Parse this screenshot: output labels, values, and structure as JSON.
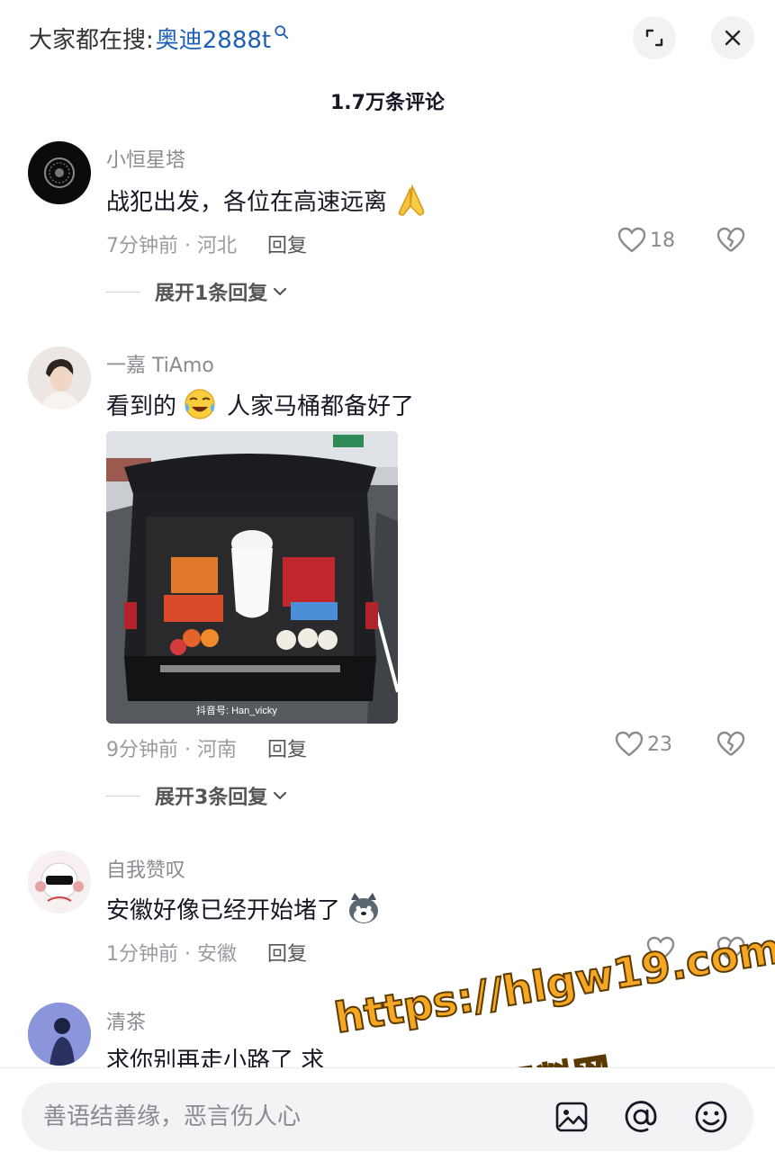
{
  "header": {
    "search_prefix": "大家都在搜:",
    "search_keyword": "奥迪2888t",
    "comment_count": "1.7万条评论"
  },
  "comments": [
    {
      "username": "小恒星塔",
      "text": "战犯出发，各位在高速远离",
      "emoji": "pray-hands",
      "time_location": "7分钟前 · 河北",
      "reply_label": "回复",
      "likes": "18",
      "expand_label": "展开1条回复"
    },
    {
      "username": "一嘉 TiAmo",
      "text_before": "看到的",
      "text_after": "人家马桶都备好了",
      "emoji": "crying-laughing",
      "image_description_watermark": "抖音号: Han_vicky",
      "time_location": "9分钟前 · 河南",
      "reply_label": "回复",
      "likes": "23",
      "expand_label": "展开3条回复"
    },
    {
      "username": "自我赞叹",
      "text": "安徽好像已经开始堵了",
      "emoji": "husky",
      "time_location": "1分钟前 · 安徽",
      "reply_label": "回复",
      "likes": ""
    },
    {
      "username": "清茶",
      "text": "求你别再走小路了 求"
    }
  ],
  "input": {
    "placeholder": "善语结善缘，恶言伤人心"
  },
  "watermark": {
    "url": "https://hlgw19.com",
    "name": "黑料网"
  },
  "colors": {
    "accent_link": "#1f5fb8",
    "text_primary": "#161823",
    "text_secondary": "#8a8b91",
    "watermark": "#f5a623"
  }
}
